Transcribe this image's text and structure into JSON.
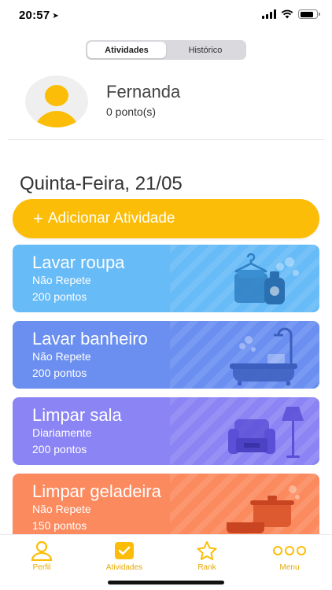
{
  "status": {
    "time": "20:57",
    "location_icon": "location-arrow-icon",
    "battery_level": 0.72
  },
  "segmented": {
    "tabs": [
      {
        "label": "Atividades",
        "active": true
      },
      {
        "label": "Histórico",
        "active": false
      }
    ]
  },
  "profile": {
    "name": "Fernanda",
    "points": "0 ponto(s)"
  },
  "date_title": "Quinta-Feira, 21/05",
  "add_button": {
    "plus": "+",
    "label": "Adicionar Atividade"
  },
  "activities": [
    {
      "title": "Lavar roupa",
      "frequency": "Não Repete",
      "points": "200 pontos",
      "color": "#67bbf7",
      "icon": "laundry-icon"
    },
    {
      "title": "Lavar banheiro",
      "frequency": "Não Repete",
      "points": "200 pontos",
      "color": "#6a8ff0",
      "icon": "bathtub-icon"
    },
    {
      "title": "Limpar sala",
      "frequency": "Diariamente",
      "points": "200 pontos",
      "color": "#8b84f4",
      "icon": "living-room-icon"
    },
    {
      "title": "Limpar geladeira",
      "frequency": "Não Repete",
      "points": "150 pontos",
      "color": "#fb8a5e",
      "icon": "cookware-icon"
    }
  ],
  "tabbar": {
    "items": [
      {
        "label": "Perfil",
        "icon": "person-icon"
      },
      {
        "label": "Atividades",
        "icon": "checkbox-icon"
      },
      {
        "label": "Rank",
        "icon": "star-icon"
      },
      {
        "label": "Menu",
        "icon": "more-icon"
      }
    ],
    "accent": "#fbbd07"
  }
}
